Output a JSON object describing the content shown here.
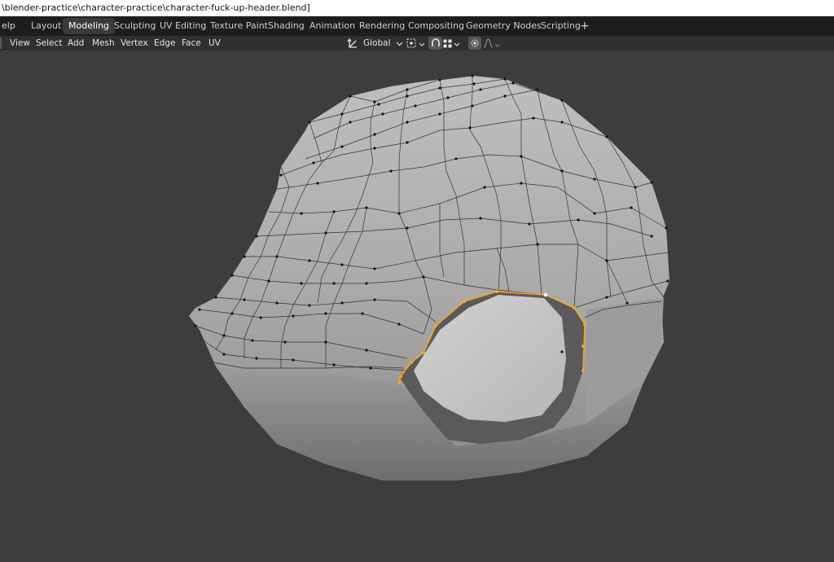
{
  "titlebar": {
    "path": "\\blender-practice\\character-practice\\character-fuck-up-header.blend]"
  },
  "topbar": {
    "menu_fragment": "elp",
    "workspace_tabs": [
      {
        "label": "Layout"
      },
      {
        "label": "Modeling",
        "active": true
      },
      {
        "label": "Sculpting"
      },
      {
        "label": "UV Editing"
      },
      {
        "label": "Texture Paint"
      },
      {
        "label": "Shading"
      },
      {
        "label": "Animation"
      },
      {
        "label": "Rendering"
      },
      {
        "label": "Compositing"
      },
      {
        "label": "Geometry Nodes"
      },
      {
        "label": "Scripting"
      }
    ],
    "add_workspace": "+"
  },
  "header": {
    "menus": [
      "View",
      "Select",
      "Add",
      "Mesh",
      "Vertex",
      "Edge",
      "Face",
      "UV"
    ],
    "transform_orientation": "Global",
    "icons": {
      "orientation": "transform-orientation-icon",
      "pivot": "pivot-point-icon",
      "snap": "snap-magnet-icon",
      "snap_target": "snap-increment-icon",
      "proportional": "proportional-edit-icon",
      "falloff": "falloff-curve-icon"
    }
  },
  "colors": {
    "topbar": "#1d1d1d",
    "header": "#303030",
    "viewport": "#3d3d3d",
    "selection": "#f5a623",
    "mesh_face": "#a9a9a9"
  }
}
